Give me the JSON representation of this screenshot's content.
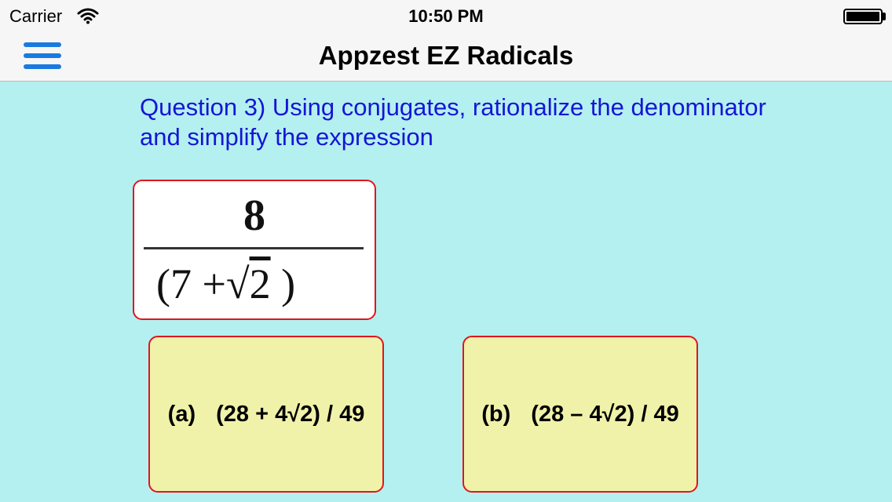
{
  "status_bar": {
    "carrier": "Carrier",
    "time": "10:50 PM",
    "wifi_icon": "wifi-icon",
    "battery_icon": "battery-icon"
  },
  "nav": {
    "title": "Appzest EZ Radicals",
    "menu_icon": "hamburger-menu-icon",
    "accent_color": "#1a7ae0"
  },
  "question": {
    "text_line1": "Question 3)  Using conjugates, rationalize the denominator",
    "text_line2": "and simplify the expression",
    "color": "#1515d5"
  },
  "expression": {
    "numerator": "8",
    "denominator_open": "(7  +",
    "radical_sign": "√",
    "radicand": "2",
    "denominator_close": " )"
  },
  "answers": [
    {
      "label": "(a)",
      "text": "(28 + 4√2) / 49"
    },
    {
      "label": "(b)",
      "text": "(28 – 4√2) / 49"
    }
  ],
  "colors": {
    "background": "#b4f0f0",
    "card_border": "#e2141e",
    "answer_fill": "#f0f2aa"
  }
}
